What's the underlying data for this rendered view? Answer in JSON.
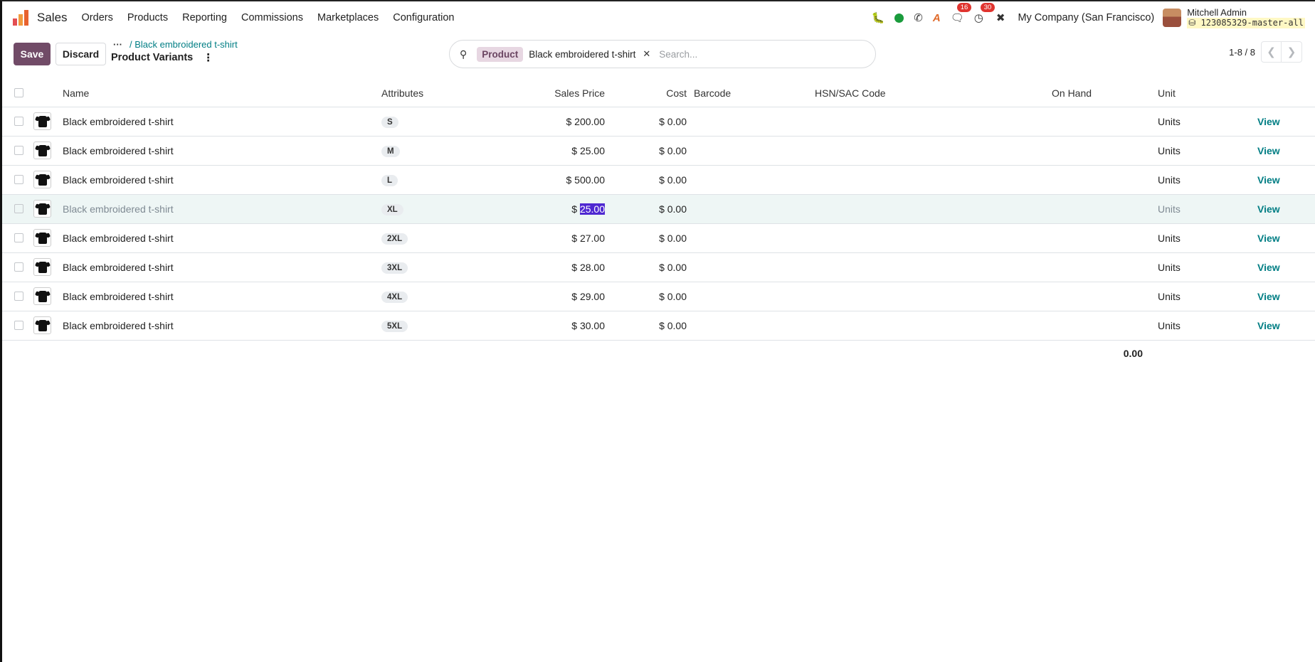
{
  "navbar": {
    "app_name": "Sales",
    "menu": [
      "Orders",
      "Products",
      "Reporting",
      "Commissions",
      "Marketplaces",
      "Configuration"
    ],
    "badges": {
      "messages": "16",
      "activities": "30"
    },
    "company": "My Company (San Francisco)",
    "user_name": "Mitchell Admin",
    "database": "⛁ 123085329-master-all"
  },
  "control": {
    "save_label": "Save",
    "discard_label": "Discard",
    "breadcrumb_dots": "···",
    "breadcrumb_parent": "/ Black embroidered t-shirt",
    "page_title": "Product Variants",
    "search": {
      "facet_label": "Product",
      "facet_value": "Black embroidered t-shirt",
      "placeholder": "Search..."
    },
    "pager_value": "1-8 / 8"
  },
  "table": {
    "headers": {
      "name": "Name",
      "attributes": "Attributes",
      "sales_price": "Sales Price",
      "cost": "Cost",
      "barcode": "Barcode",
      "hsn": "HSN/SAC Code",
      "on_hand": "On Hand",
      "unit": "Unit"
    },
    "view_label": "View",
    "rows": [
      {
        "name": "Black embroidered t-shirt",
        "attribute": "S",
        "price": "$ 200.00",
        "cost": "$ 0.00",
        "unit": "Units"
      },
      {
        "name": "Black embroidered t-shirt",
        "attribute": "M",
        "price": "$ 25.00",
        "cost": "$ 0.00",
        "unit": "Units"
      },
      {
        "name": "Black embroidered t-shirt",
        "attribute": "L",
        "price": "$ 500.00",
        "cost": "$ 0.00",
        "unit": "Units"
      },
      {
        "name": "Black embroidered t-shirt",
        "attribute": "XL",
        "price_prefix": "$ ",
        "price_selected": "25.00",
        "cost": "$ 0.00",
        "unit": "Units"
      },
      {
        "name": "Black embroidered t-shirt",
        "attribute": "2XL",
        "price": "$ 27.00",
        "cost": "$ 0.00",
        "unit": "Units"
      },
      {
        "name": "Black embroidered t-shirt",
        "attribute": "3XL",
        "price": "$ 28.00",
        "cost": "$ 0.00",
        "unit": "Units"
      },
      {
        "name": "Black embroidered t-shirt",
        "attribute": "4XL",
        "price": "$ 29.00",
        "cost": "$ 0.00",
        "unit": "Units"
      },
      {
        "name": "Black embroidered t-shirt",
        "attribute": "5XL",
        "price": "$ 30.00",
        "cost": "$ 0.00",
        "unit": "Units"
      }
    ],
    "on_hand_total": "0.00"
  },
  "colors": {
    "primary": "#714b67",
    "link": "#017e84",
    "badge": "#e0342f",
    "selection": "#4f28d1"
  }
}
